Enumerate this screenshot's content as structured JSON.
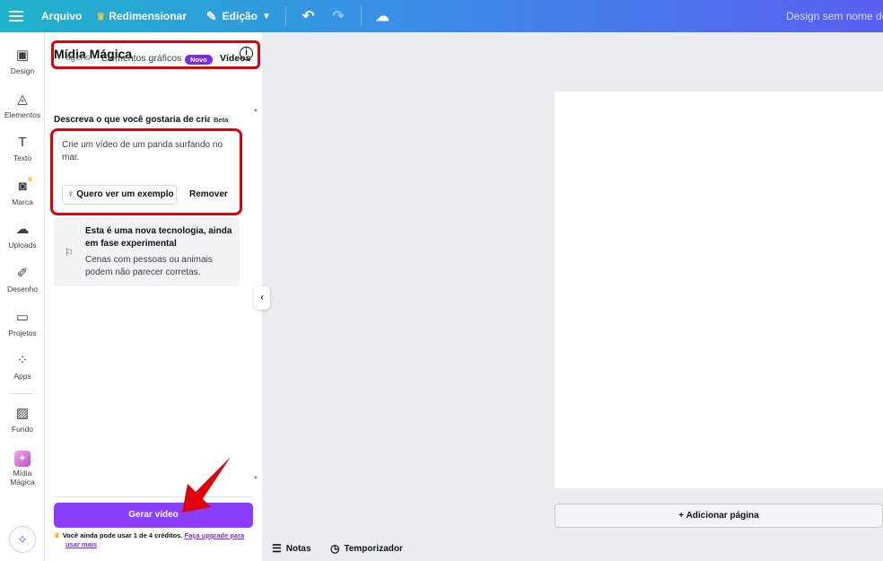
{
  "topbar": {
    "file": "Arquivo",
    "resize": "Redimensionar",
    "edit": "Edição",
    "doc_title": "Design sem nome de Po"
  },
  "rail": {
    "items": [
      {
        "label": "Design",
        "icon": "layout-icon"
      },
      {
        "label": "Elementos",
        "icon": "shapes-icon"
      },
      {
        "label": "Texto",
        "icon": "text-icon"
      },
      {
        "label": "Marca",
        "icon": "brand-icon"
      },
      {
        "label": "Uploads",
        "icon": "cloud-upload-icon"
      },
      {
        "label": "Desenho",
        "icon": "draw-icon"
      },
      {
        "label": "Projetos",
        "icon": "folder-icon"
      },
      {
        "label": "Apps",
        "icon": "apps-icon"
      },
      {
        "label": "Fundo",
        "icon": "background-icon"
      },
      {
        "label": "Mídia Mágica",
        "icon": "magic-media-icon"
      }
    ]
  },
  "panel": {
    "title": "Mídia Mágica",
    "tabs": {
      "prev": "agens",
      "graphics": "Elementos gráficos",
      "graphics_badge": "Novo",
      "videos": "Vídeos"
    },
    "prompt_label": "Descreva o que você gostaria de criar",
    "prompt_badge": "Beta",
    "prompt_text": "Crie um vídeo de um panda surfando no mar.",
    "example_button": "Quero ver um exemplo",
    "remove_button": "Remover",
    "notice_title": "Esta é uma nova tecnologia, ainda em fase experimental",
    "notice_body": "Cenas com pessoas ou animais podem não parecer corretas.",
    "generate_button": "Gerar vídeo",
    "credits_text": "Você ainda pode usar 1 de 4 créditos.",
    "upgrade_link_1": "Faça upgrade para",
    "upgrade_link_2": "usar mais"
  },
  "canvas": {
    "add_page": "Adicionar página"
  },
  "bottom": {
    "notes": "Notas",
    "timer": "Temporizador"
  },
  "colors": {
    "accent": "#8b3dff",
    "highlight": "#e0000b"
  }
}
